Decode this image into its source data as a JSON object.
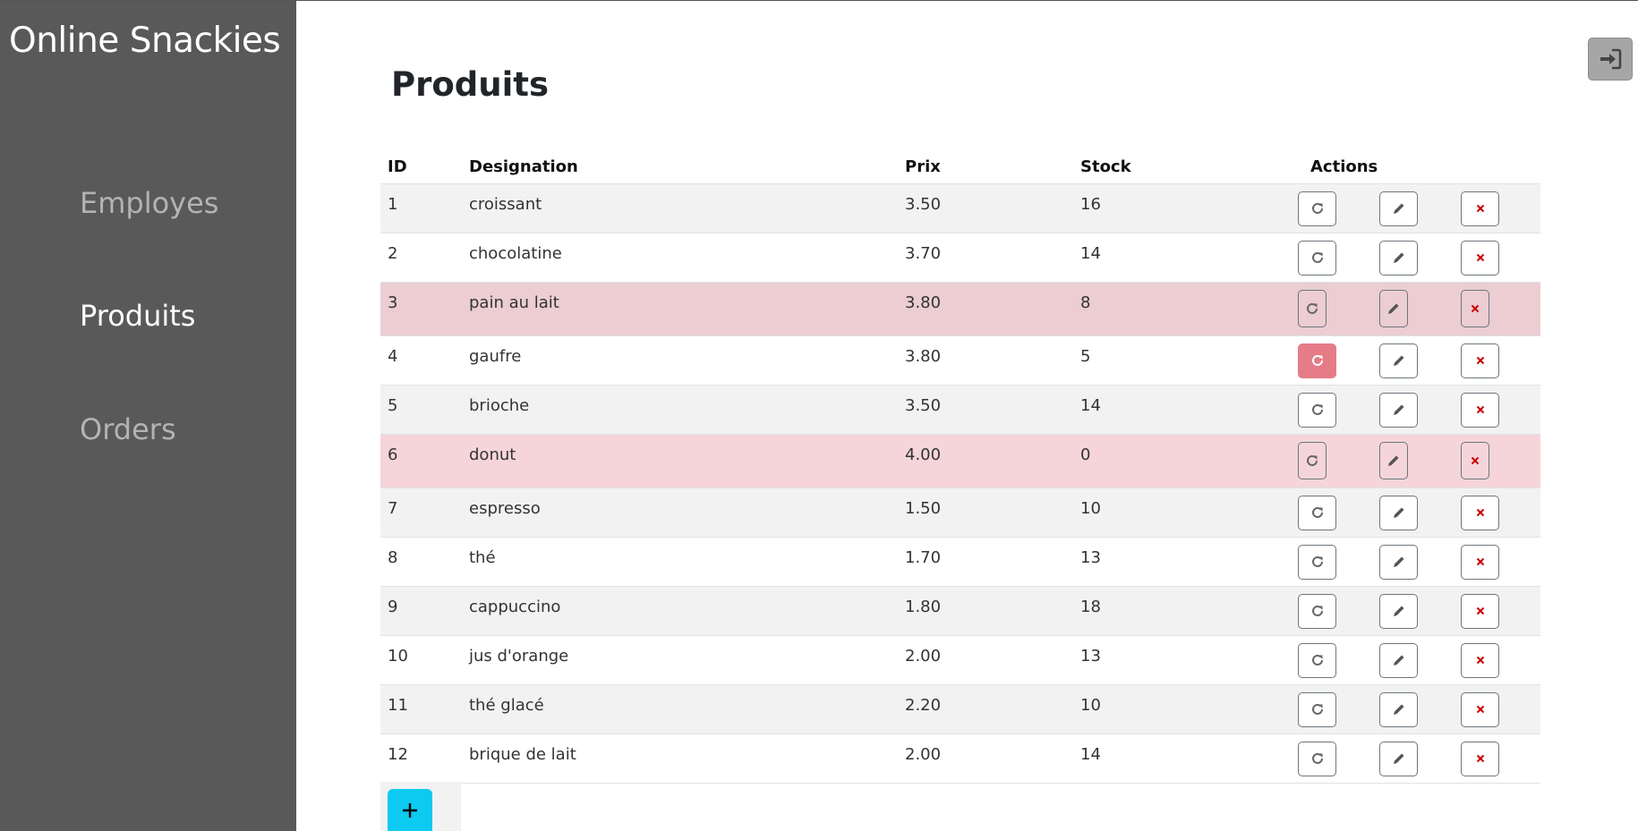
{
  "app": {
    "brand": "Online Snackies"
  },
  "nav": {
    "items": [
      {
        "label": "Employes",
        "active": false
      },
      {
        "label": "Produits",
        "active": true
      },
      {
        "label": "Orders",
        "active": false
      }
    ]
  },
  "header": {
    "login_icon": "sign-in-icon"
  },
  "page": {
    "title": "Produits"
  },
  "table": {
    "columns": [
      "ID",
      "Designation",
      "Prix",
      "Stock",
      "Actions"
    ],
    "rows": [
      {
        "id": "1",
        "designation": "croissant",
        "prix": "3.50",
        "stock": "16",
        "status": "normal"
      },
      {
        "id": "2",
        "designation": "chocolatine",
        "prix": "3.70",
        "stock": "14",
        "status": "normal"
      },
      {
        "id": "3",
        "designation": "pain au lait",
        "prix": "3.80",
        "stock": "8",
        "status": "warning"
      },
      {
        "id": "4",
        "designation": "gaufre",
        "prix": "3.80",
        "stock": "5",
        "status": "normal"
      },
      {
        "id": "5",
        "designation": "brioche",
        "prix": "3.50",
        "stock": "14",
        "status": "normal"
      },
      {
        "id": "6",
        "designation": "donut",
        "prix": "4.00",
        "stock": "0",
        "status": "danger"
      },
      {
        "id": "7",
        "designation": "espresso",
        "prix": "1.50",
        "stock": "10",
        "status": "normal"
      },
      {
        "id": "8",
        "designation": "thé",
        "prix": "1.70",
        "stock": "13",
        "status": "normal"
      },
      {
        "id": "9",
        "designation": "cappuccino",
        "prix": "1.80",
        "stock": "18",
        "status": "normal"
      },
      {
        "id": "10",
        "designation": "jus d'orange",
        "prix": "2.00",
        "stock": "13",
        "status": "normal"
      },
      {
        "id": "11",
        "designation": "thé glacé",
        "prix": "2.20",
        "stock": "10",
        "status": "normal"
      },
      {
        "id": "12",
        "designation": "brique de lait",
        "prix": "2.00",
        "stock": "14",
        "status": "normal"
      }
    ],
    "actions": [
      "restock-icon",
      "edit-icon",
      "delete-icon"
    ],
    "highlighted_restock_row": "4"
  },
  "add_button": {
    "icon": "plus-icon",
    "label": "+"
  },
  "colors": {
    "sidebar": "#595959",
    "stripe": "#f2f2f2",
    "warning_row": "#ebcdd2",
    "danger_row": "#f5d5da",
    "restock_active": "#e57c88",
    "add_button": "#0dcaf0",
    "delete_icon": "#cc0000"
  }
}
